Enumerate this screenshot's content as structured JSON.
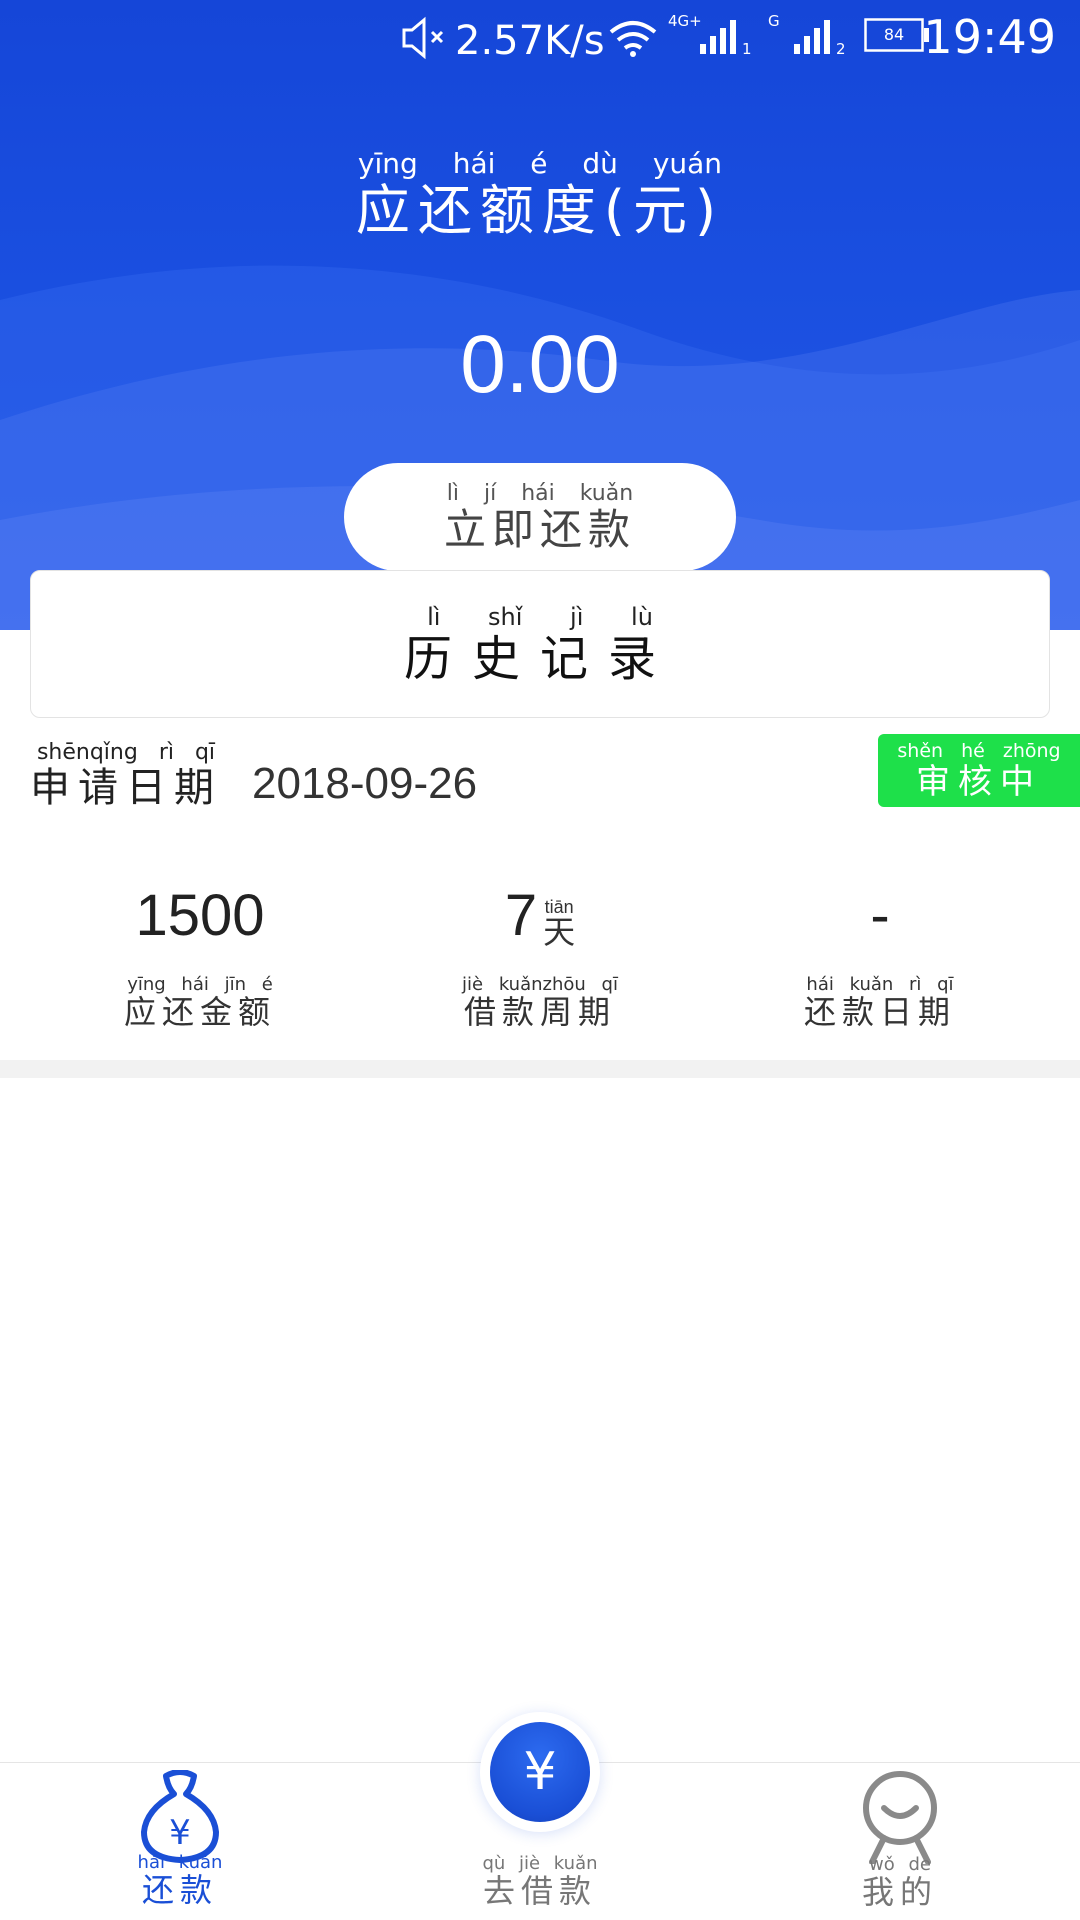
{
  "status_bar": {
    "network_speed": "2.57K/s",
    "signal1_label": "4G+",
    "signal1_sim": "1",
    "signal2_label": "G",
    "signal2_sim": "2",
    "battery": "84",
    "time": "19:49"
  },
  "amount": {
    "title_pinyin": "yīng hái é dù yuán",
    "title": "应还额度(元)",
    "value": "0.00"
  },
  "pay_button": {
    "pinyin": "lì jí hái kuǎn",
    "label": "立即还款"
  },
  "history": {
    "pinyin": "lì shǐ jì lù",
    "label": "历史记录"
  },
  "application": {
    "date_label_pinyin": "shēnqǐng rì qī",
    "date_label": "申请日期",
    "date": "2018-09-26",
    "status_pinyin": "shěn hé zhōng",
    "status": "审核中"
  },
  "stats": {
    "amount_value": "1500",
    "amount_label_pinyin": "yīng hái jīn é",
    "amount_label": "应还金额",
    "period_value": "7",
    "period_unit_pinyin": "tiān",
    "period_unit": "天",
    "period_label_pinyin": "jiè kuǎnzhōu qī",
    "period_label": "借款周期",
    "repay_date_value": "-",
    "repay_date_label_pinyin": "hái kuǎn rì qī",
    "repay_date_label": "还款日期"
  },
  "bottom_nav": {
    "repay_pinyin": "hái kuǎn",
    "repay": "还款",
    "borrow_pinyin": "qù jiè kuǎn",
    "borrow": "去借款",
    "mine_pinyin": "wǒ de",
    "mine": "我的",
    "fab_symbol": "¥",
    "repay_icon_symbol": "¥"
  },
  "colors": {
    "primary_blue": "#1a4fd6",
    "status_green": "#1ee04a",
    "nav_inactive": "#777777"
  },
  "icons": {
    "status_bar": [
      "mute-icon",
      "wifi-icon",
      "signal-icon",
      "battery-icon"
    ],
    "nav": [
      "money-bag-icon",
      "yuan-icon",
      "person-icon"
    ]
  }
}
